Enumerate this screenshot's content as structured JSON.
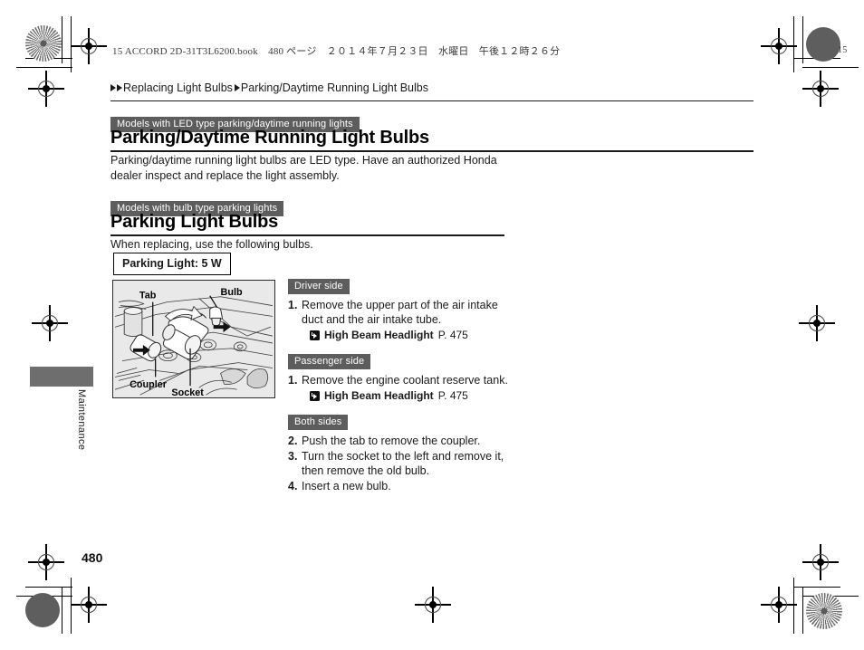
{
  "print_marks": {
    "book_line": "15 ACCORD 2D-31T3L6200.book　480 ページ　２０１４年７月２３日　水曜日　午後１２時２６分",
    "corner_mark_top_right_label": "15"
  },
  "breadcrumb": {
    "parent": "Replacing Light Bulbs",
    "current": "Parking/Daytime Running Light Bulbs"
  },
  "sections": [
    {
      "chip": "Models with LED type parking/daytime running lights",
      "title": "Parking/Daytime Running Light Bulbs",
      "body": "Parking/daytime running light bulbs are LED type. Have an authorized Honda dealer inspect and replace the light assembly."
    },
    {
      "chip": "Models with bulb type parking lights",
      "title": "Parking Light Bulbs",
      "body": "When replacing, use the following bulbs.",
      "spec": "Parking Light: 5 W"
    }
  ],
  "figure": {
    "labels": {
      "tab": "Tab",
      "bulb": "Bulb",
      "coupler": "Coupler",
      "socket": "Socket"
    }
  },
  "procedure": {
    "groups": [
      {
        "chip": "Driver side",
        "steps": [
          {
            "num": "1.",
            "text": "Remove the upper part of the air intake duct and the air intake tube."
          }
        ],
        "xref": {
          "title": "High Beam Headlight",
          "page": "P. 475"
        }
      },
      {
        "chip": "Passenger side",
        "steps": [
          {
            "num": "1.",
            "text": "Remove the engine coolant reserve tank."
          }
        ],
        "xref": {
          "title": "High Beam Headlight",
          "page": "P. 475"
        }
      },
      {
        "chip": "Both sides",
        "steps": [
          {
            "num": "2.",
            "text": "Push the tab to remove the coupler."
          },
          {
            "num": "3.",
            "text": "Turn the socket to the left and remove it, then remove the old bulb."
          },
          {
            "num": "4.",
            "text": "Insert a new bulb."
          }
        ]
      }
    ]
  },
  "side_tab": {
    "label": "Maintenance"
  },
  "footer": {
    "page_number": "480"
  },
  "colors": {
    "chip_bg": "#5d5d5d",
    "side_tab_bg": "#6e6e6e",
    "figure_bg": "#e9e9e9",
    "rule": "#1a1a1a"
  }
}
